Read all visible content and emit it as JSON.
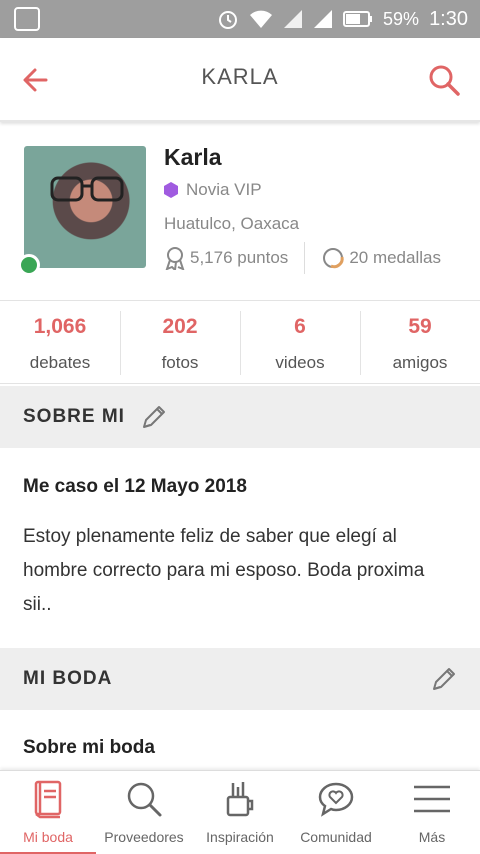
{
  "status_bar": {
    "battery": "59%",
    "time": "1:30"
  },
  "header": {
    "title": "KARLA"
  },
  "profile": {
    "name": "Karla",
    "badge": "Novia VIP",
    "location": "Huatulco, Oaxaca",
    "points": "5,176 puntos",
    "medals": "20 medallas"
  },
  "stats": [
    {
      "value": "1,066",
      "label": "debates"
    },
    {
      "value": "202",
      "label": "fotos"
    },
    {
      "value": "6",
      "label": "videos"
    },
    {
      "value": "59",
      "label": "amigos"
    }
  ],
  "about": {
    "title": "SOBRE MI",
    "date": "Me caso el 12 Mayo 2018",
    "text": "Estoy plenamente feliz de saber que elegí al hombre correcto para mi esposo. Boda proxima sii.."
  },
  "wedding": {
    "title": "MI BODA",
    "subtitle": "Sobre mi boda"
  },
  "nav": [
    {
      "label": "Mi boda",
      "icon": "book-icon",
      "active": true
    },
    {
      "label": "Proveedores",
      "icon": "search-icon"
    },
    {
      "label": "Inspiración",
      "icon": "tools-icon"
    },
    {
      "label": "Comunidad",
      "icon": "chat-heart-icon"
    },
    {
      "label": "Más",
      "icon": "menu-icon"
    }
  ],
  "colors": {
    "accent": "#e06565",
    "section_bg": "#eeeeee",
    "online": "#3aa655",
    "vip": "#a05be0"
  }
}
